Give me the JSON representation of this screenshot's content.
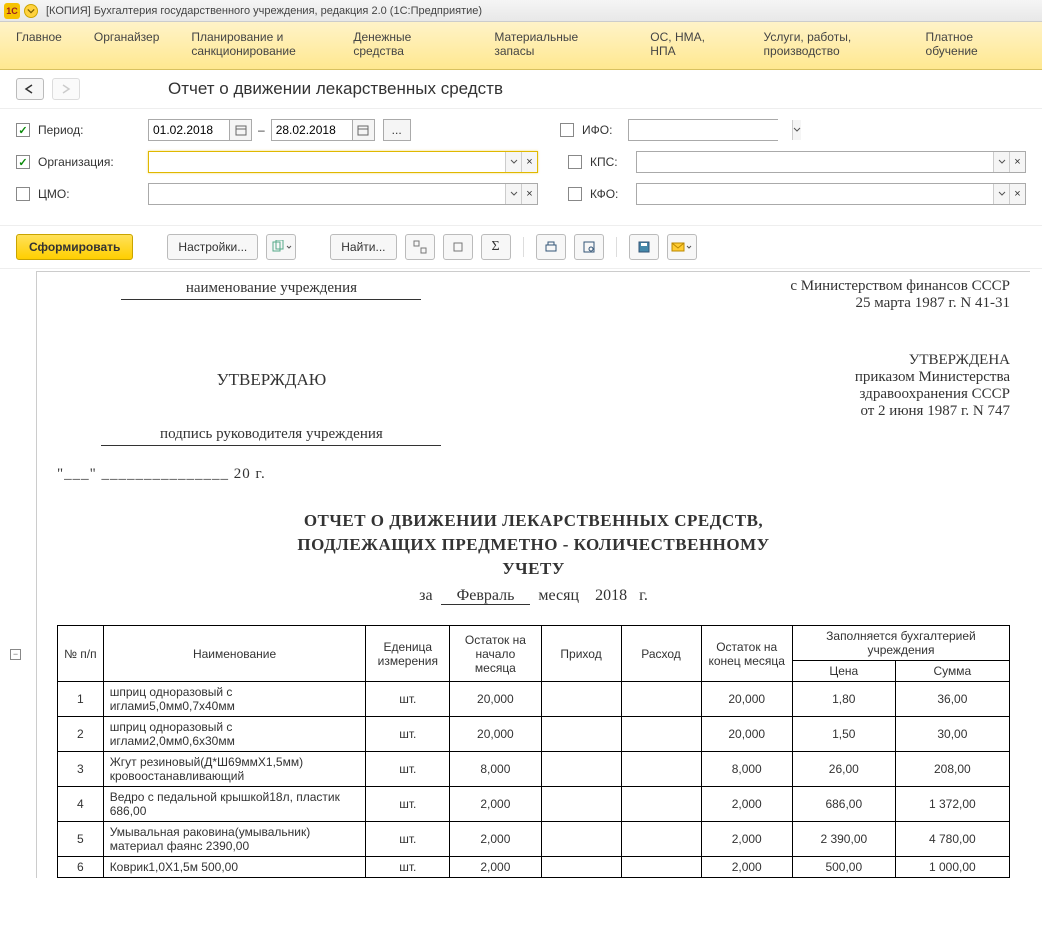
{
  "titlebar": {
    "text": "[КОПИЯ] Бухгалтерия государственного учреждения, редакция 2.0  (1С:Предприятие)"
  },
  "menubar": [
    "Главное",
    "Органайзер",
    "Планирование и санкционирование",
    "Денежные средства",
    "Материальные запасы",
    "ОС, НМА, НПА",
    "Услуги, работы, производство",
    "Платное обучение"
  ],
  "page_title": "Отчет о движении лекарственных средств",
  "filters": {
    "period": {
      "label": "Период:",
      "checked": true,
      "from": "01.02.2018",
      "to": "28.02.2018"
    },
    "org": {
      "label": "Организация:",
      "checked": true
    },
    "cmo": {
      "label": "ЦМО:",
      "checked": false
    },
    "ifo": {
      "label": "ИФО:",
      "checked": false
    },
    "kps": {
      "label": "КПС:",
      "checked": false
    },
    "kfo": {
      "label": "КФО:",
      "checked": false
    }
  },
  "toolbar": {
    "form": "Сформировать",
    "settings": "Настройки...",
    "find": "Найти..."
  },
  "doc": {
    "inst_name": "наименование учреждения",
    "approve": "УТВЕРЖДАЮ",
    "sign_label": "подпись руководителя учреждения",
    "date_blank": "\"___\" _______________ 20      г.",
    "right_top_1": "с Министерством финансов СССР",
    "right_top_2": "25 марта 1987 г. N 41-31",
    "right_mid_1": "УТВЕРЖДЕНА",
    "right_mid_2": "приказом Министерства",
    "right_mid_3": "здравоохранения СССР",
    "right_mid_4": "от 2 июня 1987 г. N 747",
    "title_1": "ОТЧЕТ О ДВИЖЕНИИ ЛЕКАРСТВЕННЫХ СРЕДСТВ,",
    "title_2": "ПОДЛЕЖАЩИХ ПРЕДМЕТНО - КОЛИЧЕСТВЕННОМУ",
    "title_3": "УЧЕТУ",
    "month_prefix": "за",
    "month": "Февраль",
    "month_word": "месяц",
    "year": "2018",
    "year_suffix": "г."
  },
  "table": {
    "headers": {
      "num": "№ п/п",
      "name": "Наименование",
      "unit": "Еденица измерения",
      "start": "Остаток на начало месяца",
      "in": "Приход",
      "out": "Расход",
      "end": "Остаток на конец месяца",
      "acc": "Заполняется бухгалтерией учреждения",
      "price": "Цена",
      "sum": "Сумма"
    },
    "rows": [
      {
        "n": "1",
        "name": "шприц одноразовый с иглами5,0мм0,7х40мм",
        "unit": "шт.",
        "start": "20,000",
        "in": "",
        "out": "",
        "end": "20,000",
        "price": "1,80",
        "sum": "36,00"
      },
      {
        "n": "2",
        "name": "шприц одноразовый с иглами2,0мм0,6х30мм",
        "unit": "шт.",
        "start": "20,000",
        "in": "",
        "out": "",
        "end": "20,000",
        "price": "1,50",
        "sum": "30,00"
      },
      {
        "n": "3",
        "name": "Жгут резиновый(Д*Ш69ммХ1,5мм) кровоостанавливающий",
        "unit": "шт.",
        "start": "8,000",
        "in": "",
        "out": "",
        "end": "8,000",
        "price": "26,00",
        "sum": "208,00"
      },
      {
        "n": "4",
        "name": "Ведро с педальной крышкой18л, пластик 686,00",
        "unit": "шт.",
        "start": "2,000",
        "in": "",
        "out": "",
        "end": "2,000",
        "price": "686,00",
        "sum": "1 372,00"
      },
      {
        "n": "5",
        "name": "Умывальная раковина(умывальник) материал фаянс 2390,00",
        "unit": "шт.",
        "start": "2,000",
        "in": "",
        "out": "",
        "end": "2,000",
        "price": "2 390,00",
        "sum": "4 780,00"
      },
      {
        "n": "6",
        "name": "Коврик1,0Х1,5м 500,00",
        "unit": "шт.",
        "start": "2,000",
        "in": "",
        "out": "",
        "end": "2,000",
        "price": "500,00",
        "sum": "1 000,00"
      }
    ]
  }
}
